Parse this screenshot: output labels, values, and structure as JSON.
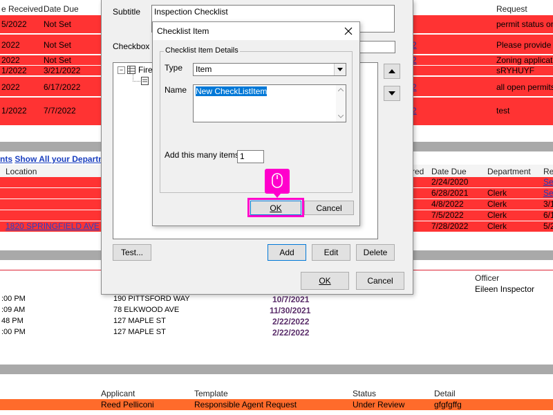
{
  "top_grid": {
    "headers": {
      "received": "e Received",
      "due": "Date Due",
      "request": "Request"
    },
    "rows": [
      {
        "received": "5/2022",
        "due": "Not Set",
        "request": "permit status on"
      },
      {
        "received": "2022",
        "due": "Not Set",
        "request": "Please provide a"
      },
      {
        "received": "2022",
        "due": "Not Set",
        "request": "Zoning applicatio"
      },
      {
        "received": "1/2022",
        "due": "3/21/2022",
        "request": "sRYHUYF"
      },
      {
        "received": "2022",
        "due": "6/17/2022",
        "request": "all open permits"
      },
      {
        "received": "1/2022",
        "due": "7/7/2022",
        "request": "test"
      }
    ],
    "link_fragments": [
      "2",
      "2",
      "2",
      "2"
    ]
  },
  "mid_section": {
    "links": {
      "left": "nts",
      "show_all": "Show All your Departm"
    },
    "headers": {
      "location": "Location",
      "red": "red",
      "due": "Date Due",
      "dept": "Department",
      "re": "Re"
    },
    "rows": [
      {
        "due": "2/24/2020",
        "dept": "",
        "re": "Se"
      },
      {
        "due": "6/28/2021",
        "dept": "Clerk",
        "re": "Se"
      },
      {
        "due": "4/8/2022",
        "dept": "Clerk",
        "re": "3/1"
      },
      {
        "due": "7/5/2022",
        "dept": "Clerk",
        "re": "6/1"
      },
      {
        "due": "7/28/2022",
        "dept": "Clerk",
        "re": "5/2"
      }
    ],
    "address_link": "1820 SPRINGFIELD AVE"
  },
  "inspections": {
    "officer_header": "Officer",
    "officer_name": "Eileen Inspector",
    "rows": [
      {
        "time": ":00 PM",
        "address": "190 PITTSFORD WAY",
        "date": "10/7/2021"
      },
      {
        "time": ":09 AM",
        "address": "78 ELKWOOD AVE",
        "date": "11/30/2021"
      },
      {
        "time": "48 PM",
        "address": "127 MAPLE ST",
        "date": "2/22/2022"
      },
      {
        "time": ":00 PM",
        "address": "127 MAPLE ST",
        "date": "2/22/2022"
      }
    ]
  },
  "bottom_grid": {
    "headers": {
      "applicant": "Applicant",
      "template": "Template",
      "status": "Status",
      "detail": "Detail"
    },
    "row": {
      "applicant": "Reed Pelliconi",
      "template": "Responsible Agent Request",
      "status": "Under Review",
      "detail": "gfgfgffg"
    }
  },
  "outer_dialog": {
    "subtitle_label": "Subtitle",
    "subtitle_value": "Inspection Checklist",
    "checkbox_label": "Checkbox He",
    "tree_root": "Fire",
    "test_button": "Test...",
    "add_button": "Add",
    "edit_button": "Edit",
    "delete_button": "Delete",
    "ok_button": "OK",
    "cancel_button": "Cancel"
  },
  "checklist_dialog": {
    "title": "Checklist Item",
    "group_label": "Checklist Item Details",
    "type_label": "Type",
    "type_value": "Item",
    "name_label": "Name",
    "name_value": "New CheckListItem",
    "count_label": "Add this many items",
    "count_value": "1",
    "ok_button": "OK",
    "cancel_button": "Cancel"
  },
  "colors": {
    "red_row": "#ff3333",
    "orange_row": "#ff6b2b",
    "highlight": "#ff00cc",
    "selection": "#0078d7"
  }
}
